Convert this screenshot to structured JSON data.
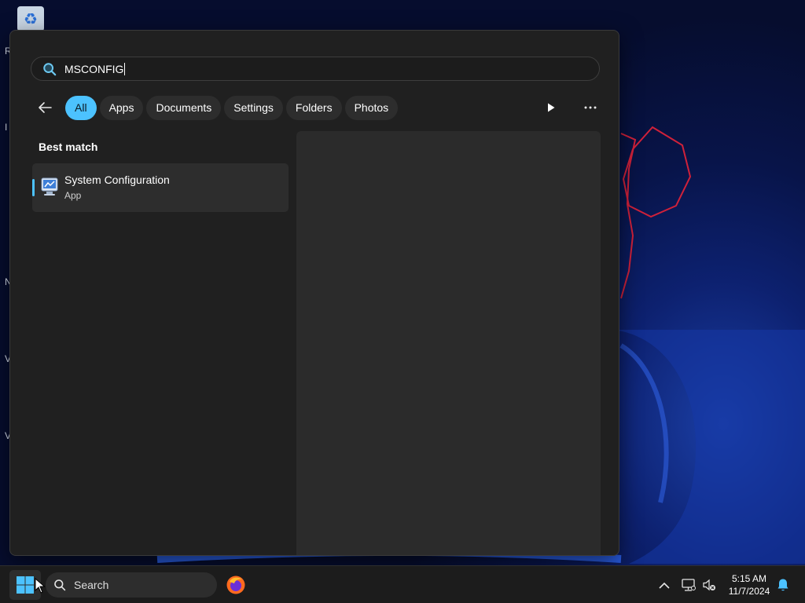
{
  "search": {
    "query": "MSCONFIG"
  },
  "filters": [
    {
      "label": "All",
      "active": true
    },
    {
      "label": "Apps",
      "active": false
    },
    {
      "label": "Documents",
      "active": false
    },
    {
      "label": "Settings",
      "active": false
    },
    {
      "label": "Folders",
      "active": false
    },
    {
      "label": "Photos",
      "active": false
    }
  ],
  "results": {
    "section_label": "Best match",
    "best_match": {
      "name": "System Configuration",
      "type": "App",
      "icon": "system-configuration-icon"
    }
  },
  "taskbar": {
    "search_label": "Search",
    "pinned": [
      "firefox-icon"
    ],
    "tray_icons": [
      "chevron-up-icon",
      "network-icon",
      "volume-muted-icon",
      "bell-icon"
    ],
    "clock": {
      "time": "5:15 AM",
      "date": "11/7/2024"
    }
  },
  "colors": {
    "accent": "#4cc2ff",
    "panel_bg": "#202020",
    "taskbar_bg": "#1c1c1c"
  }
}
